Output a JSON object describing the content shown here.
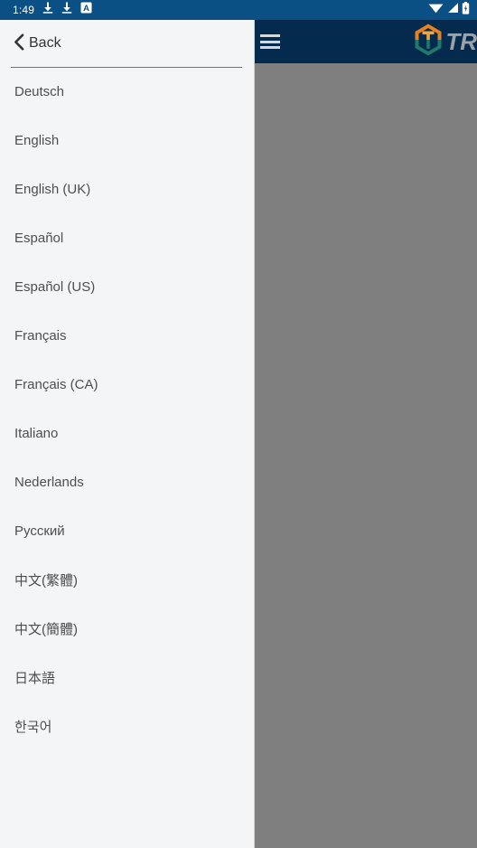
{
  "status_bar": {
    "clock": "1:49",
    "background": "#0b5085",
    "left_icons": [
      {
        "name": "download-icon",
        "glyph": "download"
      },
      {
        "name": "download-icon",
        "glyph": "download"
      },
      {
        "name": "app-badge-icon",
        "glyph": "A"
      }
    ],
    "right_icons": [
      {
        "name": "wifi-icon",
        "glyph": "wifi"
      },
      {
        "name": "cellular-signal-icon",
        "glyph": "signal"
      },
      {
        "name": "battery-icon",
        "glyph": "battery"
      }
    ]
  },
  "app_bar": {
    "background": "#042a4d",
    "menu_icon": "hamburger-menu-icon",
    "brand_name": "TR",
    "brand_text_color": "#9aa3ab",
    "logo": {
      "name": "hexagon-logo-icon",
      "top_color": "#e8821e",
      "bottom_color": "#1f7a6b",
      "accent_color": "#f4a63b"
    }
  },
  "scrim": {
    "color": "#7f7f7f"
  },
  "drawer": {
    "background": "#f4f5f7",
    "back": {
      "label": "Back",
      "icon": "chevron-left-icon"
    },
    "languages": [
      {
        "label": "Deutsch"
      },
      {
        "label": "English"
      },
      {
        "label": "English (UK)"
      },
      {
        "label": "Español"
      },
      {
        "label": "Español (US)"
      },
      {
        "label": "Français"
      },
      {
        "label": "Français (CA)"
      },
      {
        "label": "Italiano"
      },
      {
        "label": "Nederlands"
      },
      {
        "label": "Русский"
      },
      {
        "label": "中文(繁體)"
      },
      {
        "label": "中文(簡體)"
      },
      {
        "label": "日本語"
      },
      {
        "label": "한국어"
      }
    ]
  }
}
